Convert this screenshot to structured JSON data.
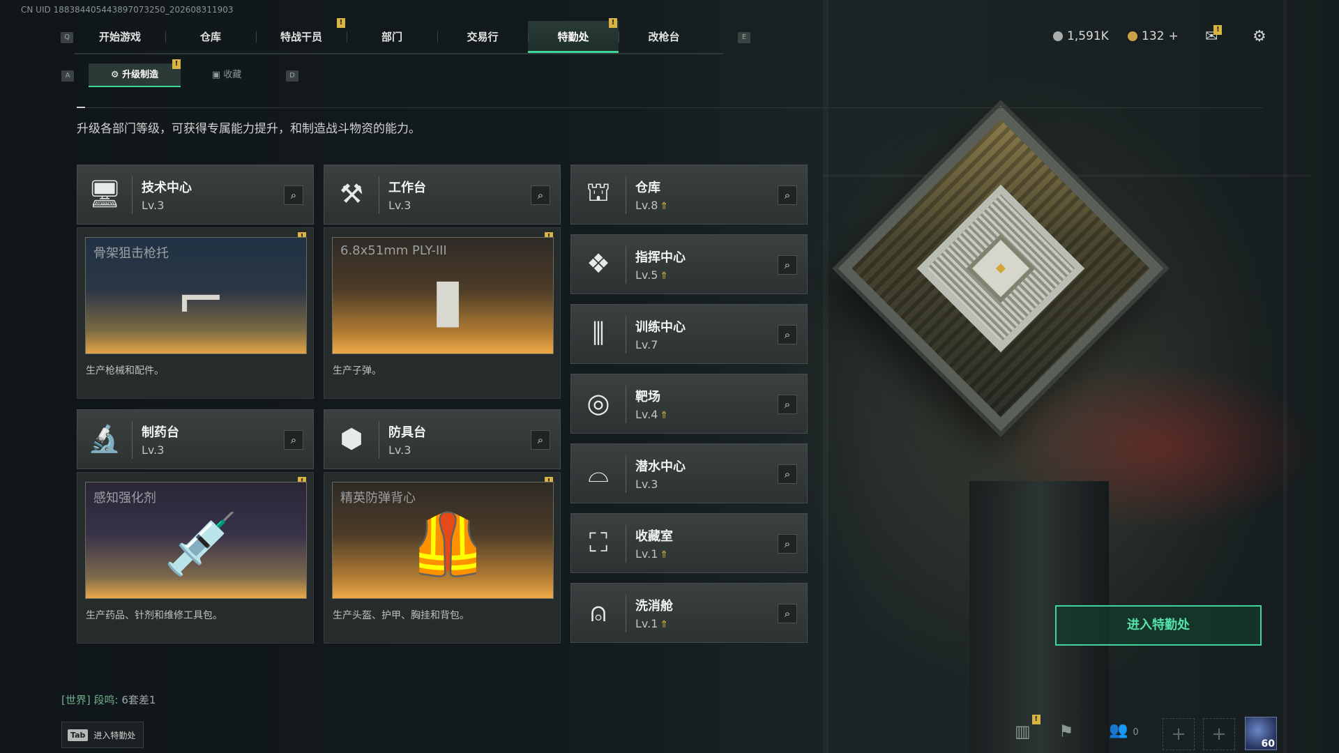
{
  "uid": "CN UID 188384405443897073250_202608311903",
  "hotkeys": {
    "prev_tab": "Q",
    "next_tab": "E",
    "prev_sub": "A",
    "next_sub": "D"
  },
  "main_tabs": [
    {
      "label": "开始游戏",
      "active": false,
      "badge": false
    },
    {
      "label": "仓库",
      "active": false,
      "badge": false
    },
    {
      "label": "特战干员",
      "active": false,
      "badge": true
    },
    {
      "label": "部门",
      "active": false,
      "badge": false
    },
    {
      "label": "交易行",
      "active": false,
      "badge": false
    },
    {
      "label": "特勤处",
      "active": true,
      "badge": true
    },
    {
      "label": "改枪台",
      "active": false,
      "badge": false
    }
  ],
  "currency": {
    "silver": "1,591K",
    "gold": "132",
    "add": "+"
  },
  "sub_tabs": [
    {
      "label": "升级制造",
      "active": true
    },
    {
      "label": "收藏",
      "active": false
    }
  ],
  "description": "升级各部门等级，可获得专属能力提升，和制造战斗物资的能力。",
  "production_departments": [
    {
      "name": "技术中心",
      "level": "Lv.3",
      "icon": "monitor-icon",
      "product": "骨架狙击枪托",
      "product_desc": "生产枪械和配件。",
      "theme": "blue"
    },
    {
      "name": "工作台",
      "level": "Lv.3",
      "icon": "hammer-icon",
      "product": "6.8x51mm PLY-III",
      "product_desc": "生产子弹。",
      "theme": "orange"
    },
    {
      "name": "制药台",
      "level": "Lv.3",
      "icon": "microscope-icon",
      "product": "感知强化剂",
      "product_desc": "生产药品、针剂和维修工具包。",
      "theme": "purple"
    },
    {
      "name": "防具台",
      "level": "Lv.3",
      "icon": "cubes-icon",
      "product": "精英防弹背心",
      "product_desc": "生产头盔、护甲、胸挂和背包。",
      "theme": "orange"
    }
  ],
  "facilities": [
    {
      "name": "仓库",
      "level": "Lv.8",
      "upgradable": true,
      "icon": "vault-icon"
    },
    {
      "name": "指挥中心",
      "level": "Lv.5",
      "upgradable": true,
      "icon": "command-icon"
    },
    {
      "name": "训练中心",
      "level": "Lv.7",
      "upgradable": false,
      "icon": "dumbbell-icon"
    },
    {
      "name": "靶场",
      "level": "Lv.4",
      "upgradable": true,
      "icon": "target-icon"
    },
    {
      "name": "潜水中心",
      "level": "Lv.3",
      "upgradable": false,
      "icon": "diving-mask-icon"
    },
    {
      "name": "收藏室",
      "level": "Lv.1",
      "upgradable": true,
      "icon": "display-case-icon"
    },
    {
      "name": "洗消舱",
      "level": "Lv.1",
      "upgradable": true,
      "icon": "decon-icon"
    }
  ],
  "enter_button": "进入特勤处",
  "chat": {
    "channel": "[世界]",
    "user": "段鸣:",
    "message": "6套差1"
  },
  "tab_hint": {
    "key": "Tab",
    "label": "进入特勤处"
  },
  "bottom": {
    "friends_count": "0",
    "player_level": "60"
  },
  "colors": {
    "accent": "#3fd69a",
    "badge": "#d9b441",
    "panel": "#2c3231"
  }
}
